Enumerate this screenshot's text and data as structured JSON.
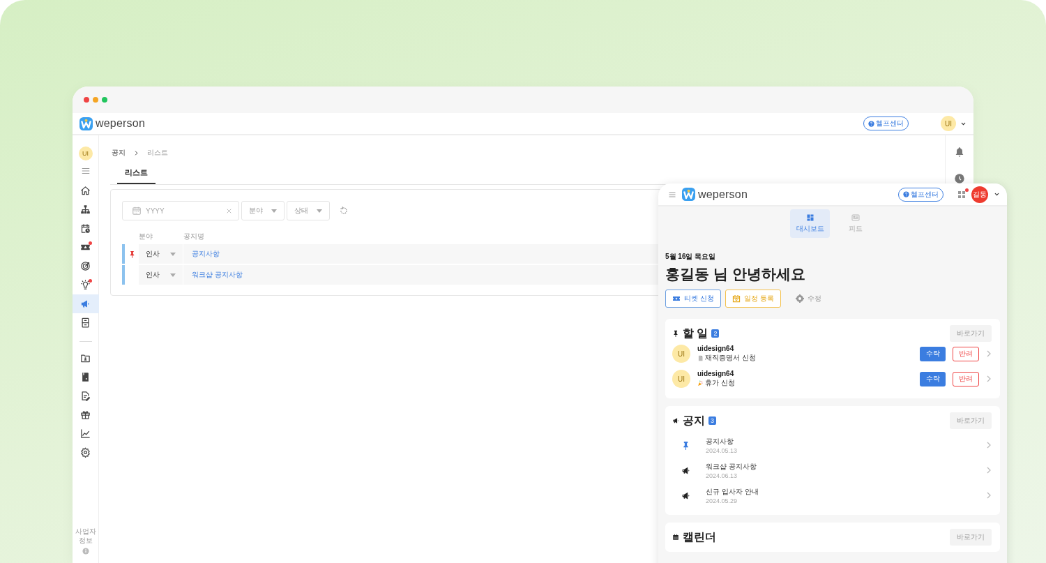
{
  "browser": {
    "logo": "weperson",
    "help": "헬프센터",
    "avatar": "UI"
  },
  "sidebar": {
    "avatar": "UI",
    "groups": [
      [
        {
          "selected": false,
          "has_badge": false
        },
        {
          "selected": false,
          "has_badge": false
        },
        {
          "selected": false,
          "has_badge": false
        },
        {
          "selected": false,
          "has_badge": true
        },
        {
          "selected": false,
          "has_badge": false
        },
        {
          "selected": false,
          "has_badge": true
        },
        {
          "selected": true,
          "has_badge": false
        },
        {
          "selected": false,
          "has_badge": false
        }
      ],
      [
        {
          "selected": false,
          "has_badge": false
        },
        {
          "selected": false,
          "has_badge": false
        },
        {
          "selected": false,
          "has_badge": false
        },
        {
          "selected": false,
          "has_badge": false
        },
        {
          "selected": false,
          "has_badge": false
        },
        {
          "selected": false,
          "has_badge": false
        }
      ]
    ],
    "footer": "사업자 정보"
  },
  "main": {
    "breadcrumb": [
      "공지",
      "리스트"
    ],
    "tabs": [
      {
        "label": "리스트",
        "selected": true
      }
    ],
    "filters": {
      "date_placeholder": "YYYY",
      "selects": [
        "분야",
        "상태"
      ]
    },
    "table": {
      "columns": [
        "분야",
        "공지명"
      ],
      "rows": [
        {
          "pinned": true,
          "category": "인사",
          "title": "공지사항"
        },
        {
          "pinned": false,
          "category": "인사",
          "title": "워크샵 공지사항"
        }
      ]
    }
  },
  "mobile": {
    "logo": "weperson",
    "help": "헬프센터",
    "apps_badge": true,
    "avatar": "길동",
    "tabs": [
      {
        "label": "대시보드",
        "selected": true
      },
      {
        "label": "피드",
        "selected": false
      }
    ],
    "date": "5월 16일 목요일",
    "greeting": "홍길동 님 안녕하세요",
    "actions": [
      {
        "kind": "ticket",
        "label": "티켓 신청"
      },
      {
        "kind": "schedule",
        "label": "일정 등록"
      },
      {
        "kind": "edit",
        "label": "수정"
      }
    ],
    "todo": {
      "title": "할 일",
      "count": "2",
      "link": "바로가기",
      "items": [
        {
          "avatar": "UI",
          "name": "uidesign64",
          "kind": "document",
          "request": "재직증명서 신청",
          "accept": "수락",
          "reject": "반려"
        },
        {
          "avatar": "UI",
          "name": "uidesign64",
          "kind": "vacation",
          "request": "휴가 신청",
          "accept": "수락",
          "reject": "반려"
        }
      ]
    },
    "notices": {
      "title": "공지",
      "count": "3",
      "link": "바로가기",
      "items": [
        {
          "kind": "pinned",
          "title": "공지사항",
          "date": "2024.05.13"
        },
        {
          "kind": "announcement",
          "title": "워크샵 공지사항",
          "date": "2024.06.13"
        },
        {
          "kind": "announcement",
          "title": "신규 입사자 안내",
          "date": "2024.05.29"
        }
      ]
    },
    "calendar": {
      "title": "캘린더",
      "link": "바로가기"
    }
  }
}
